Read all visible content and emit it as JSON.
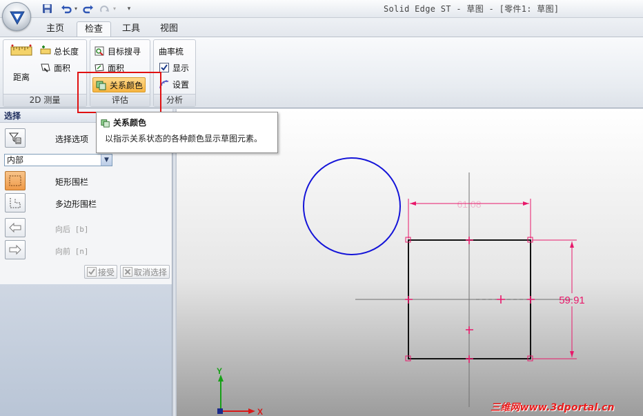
{
  "window": {
    "title": "Solid Edge ST - 草图 - [零件1: 草图]"
  },
  "tabs": [
    {
      "label": "主页",
      "active": false
    },
    {
      "label": "检查",
      "active": true
    },
    {
      "label": "工具",
      "active": false
    },
    {
      "label": "视图",
      "active": false
    }
  ],
  "ribbon": {
    "measure_group": {
      "label": "2D 测量",
      "distance": "距离",
      "total_length": "总长度",
      "area": "面积"
    },
    "evaluate_group": {
      "label": "评估",
      "target_search": "目标搜寻",
      "area": "面积",
      "relationship_color": "关系颜色"
    },
    "analysis_group": {
      "label": "分析",
      "curvature_comb": "曲率梳",
      "show": "显示",
      "show_checked": true,
      "settings": "设置"
    }
  },
  "tooltip": {
    "title": "关系颜色",
    "description": "以指示关系状态的各种颜色显示草图元素。"
  },
  "panel": {
    "header": "选择",
    "select_options": "选择选项",
    "mode_value": "内部",
    "rect_fence": "矩形围栏",
    "polygon_fence": "多边形围栏",
    "back": "向后 [b]",
    "forward": "向前 [n]",
    "accept": "接受",
    "deselect": "取消选择"
  },
  "sketch": {
    "dimension_horizontal": "61.08",
    "dimension_vertical": "59.91",
    "axis_x": "X",
    "axis_y": "Y"
  },
  "watermark": "三维网www.3dportal.cn",
  "colors": {
    "accent_orange": "#f6b440",
    "highlight_red": "#e01010",
    "dimension_magenta": "#e8186a",
    "circle_blue": "#1414d8"
  }
}
